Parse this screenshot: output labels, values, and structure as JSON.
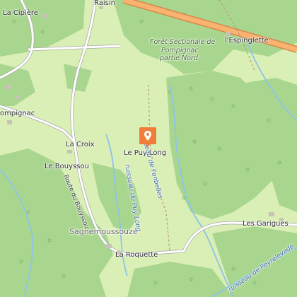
{
  "map": {
    "places": {
      "la_cipiere": "La Cipière",
      "raisin": "Raisin",
      "l_espinglette": "l'Espinglette",
      "pompignac": "ompignac",
      "la_croix": "La Croix",
      "le_puy_long": "Le Puy Long",
      "le_bouyssou": "Le Bouyssou",
      "sagnemoussouze": "Sagnemoussouze",
      "la_roquette": "La Roquette",
      "les_garigues": "Les Garigues"
    },
    "forest_label": {
      "line1": "Forêt Sectionale de",
      "line2": "Pompignac",
      "line3": "partie Nord"
    },
    "streams": {
      "fonbelles": "ruisseau de Fonbelles",
      "puy_long": "ruisseau du Puy Long",
      "peyrelevade": "ruisseau de Peyrelevade"
    },
    "roads": {
      "route_bouyssou": "Route du Bouyssou"
    },
    "colors": {
      "meadow": "#d9efb5",
      "forest": "#a9d68f",
      "road": "#ffffff",
      "major_road": "#f9b26f",
      "water": "#8fc3e8",
      "pin": "#f07d3a"
    },
    "marker_icon": "location-pin-icon"
  }
}
